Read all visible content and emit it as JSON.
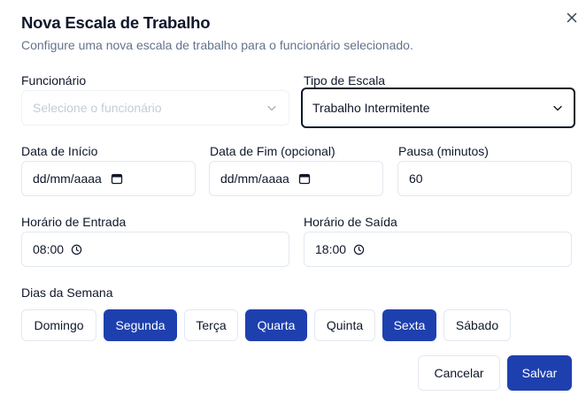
{
  "dialog": {
    "title": "Nova Escala de Trabalho",
    "subtitle": "Configure uma nova escala de trabalho para o funcionário selecionado."
  },
  "form": {
    "funcionario": {
      "label": "Funcionário",
      "placeholder": "Selecione o funcionário"
    },
    "tipo_escala": {
      "label": "Tipo de Escala",
      "value": "Trabalho Intermitente"
    },
    "data_inicio": {
      "label": "Data de Início",
      "value": "dd/mm/aaaa"
    },
    "data_fim": {
      "label": "Data de Fim (opcional)",
      "value": "dd/mm/aaaa"
    },
    "pausa": {
      "label": "Pausa (minutos)",
      "value": "60"
    },
    "horario_entrada": {
      "label": "Horário de Entrada",
      "value": "08:00"
    },
    "horario_saida": {
      "label": "Horário de Saída",
      "value": "18:00"
    },
    "dias_label": "Dias da Semana",
    "dias": [
      {
        "label": "Domingo",
        "selected": false
      },
      {
        "label": "Segunda",
        "selected": true
      },
      {
        "label": "Terça",
        "selected": false
      },
      {
        "label": "Quarta",
        "selected": true
      },
      {
        "label": "Quinta",
        "selected": false
      },
      {
        "label": "Sexta",
        "selected": true
      },
      {
        "label": "Sábado",
        "selected": false
      }
    ]
  },
  "actions": {
    "cancel": "Cancelar",
    "save": "Salvar"
  },
  "colors": {
    "primary": "#1e40af",
    "border": "#e2e8f0",
    "muted_text": "#64748b"
  },
  "icons": {
    "close": "close-icon",
    "select": "chevron-down-icon",
    "date": "calendar-icon",
    "time": "clock-icon"
  }
}
